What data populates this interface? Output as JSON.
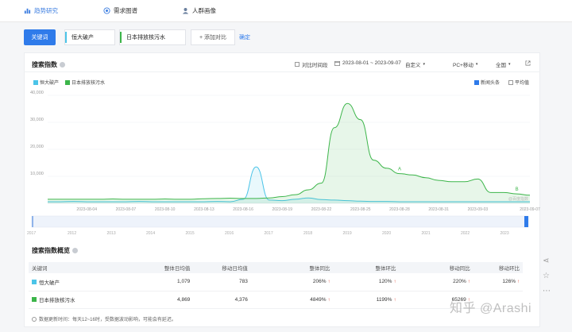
{
  "nav": {
    "items": [
      {
        "label": "趋势研究",
        "icon": "bar-chart-icon"
      },
      {
        "label": "需求图谱",
        "icon": "target-icon"
      },
      {
        "label": "人群画像",
        "icon": "user-icon"
      }
    ]
  },
  "search": {
    "keyword_button": "关键词",
    "keywords": [
      {
        "label": "恒大破产",
        "color": "#4bc4e8"
      },
      {
        "label": "日本排放核污水",
        "color": "#3cb54a"
      }
    ],
    "add_compare": "+ 添加对比",
    "confirm": "确定"
  },
  "panel": {
    "title": "搜索指数",
    "compare_period": "对比时间段",
    "date_range": "2023-08-01 ~ 2023-09-07",
    "custom": "自定义",
    "device": "PC+移动",
    "region": "全国",
    "news_headlines": "新闻头条",
    "average": "平均值"
  },
  "chart_data": {
    "type": "line",
    "ylim": [
      0,
      40000
    ],
    "yticks": [
      "40,000",
      "30,000",
      "20,000",
      "10,000"
    ],
    "x": [
      "2023-08-01",
      "2023-08-02",
      "2023-08-03",
      "2023-08-04",
      "2023-08-05",
      "2023-08-06",
      "2023-08-07",
      "2023-08-08",
      "2023-08-09",
      "2023-08-10",
      "2023-08-11",
      "2023-08-12",
      "2023-08-13",
      "2023-08-14",
      "2023-08-15",
      "2023-08-16",
      "2023-08-17",
      "2023-08-18",
      "2023-08-19",
      "2023-08-20",
      "2023-08-21",
      "2023-08-22",
      "2023-08-23",
      "2023-08-24",
      "2023-08-25",
      "2023-08-26",
      "2023-08-27",
      "2023-08-28",
      "2023-08-29",
      "2023-08-30",
      "2023-08-31",
      "2023-09-01",
      "2023-09-02",
      "2023-09-03",
      "2023-09-04",
      "2023-09-05",
      "2023-09-06",
      "2023-09-07"
    ],
    "xticks": [
      "2023-08-04",
      "2023-08-07",
      "2023-08-10",
      "2023-08-13",
      "2023-08-16",
      "2023-08-19",
      "2023-08-22",
      "2023-08-25",
      "2023-08-28",
      "2023-08-31",
      "2023-09-03",
      "2023-09-07"
    ],
    "series": [
      {
        "name": "恒大破产",
        "color": "#4bc4e8",
        "values": [
          600,
          600,
          700,
          600,
          600,
          600,
          600,
          700,
          600,
          600,
          600,
          600,
          600,
          700,
          600,
          1500,
          13500,
          1200,
          1000,
          1500,
          2000,
          1400,
          1200,
          1000,
          800,
          700,
          700,
          600,
          600,
          600,
          600,
          600,
          600,
          600,
          600,
          600,
          600,
          600
        ]
      },
      {
        "name": "日本排放核污水",
        "color": "#3cb54a",
        "values": [
          1500,
          1500,
          1500,
          1500,
          1500,
          1600,
          1500,
          1500,
          1500,
          1600,
          1500,
          1500,
          1700,
          1800,
          1900,
          1800,
          1800,
          2000,
          2500,
          3200,
          5000,
          7500,
          28000,
          37000,
          31000,
          16000,
          13000,
          11000,
          10500,
          9500,
          8500,
          8000,
          8000,
          9000,
          4000,
          4000,
          3500,
          3000
        ]
      }
    ],
    "annotations": [
      "A",
      "B"
    ],
    "watermark": "@百度指数",
    "timeline_years": [
      "2017",
      "2012",
      "2013",
      "2014",
      "2015",
      "2016",
      "2017",
      "2018",
      "2019",
      "2020",
      "2021",
      "2022",
      "2023"
    ]
  },
  "summary": {
    "title": "搜索指数概览",
    "headers": [
      "关键词",
      "整体日均值",
      "移动日均值",
      "整体同比",
      "整体环比",
      "移动同比",
      "移动环比"
    ],
    "rows": [
      {
        "keyword": "恒大破产",
        "color": "#4bc4e8",
        "overall_avg": "1,079",
        "mobile_avg": "783",
        "overall_yoy": "206%",
        "overall_mom": "120%",
        "mobile_yoy": "220%",
        "mobile_mom": "126%"
      },
      {
        "keyword": "日本排放核污水",
        "color": "#3cb54a",
        "overall_avg": "4,869",
        "mobile_avg": "4,376",
        "overall_yoy": "4849%",
        "overall_mom": "1199%",
        "mobile_yoy": "65269",
        "mobile_mom": ""
      }
    ],
    "footnote": "数据更新时间：每天12~16时，受数据波动影响，可能会有延迟。"
  },
  "watermark": "知乎 @Arashi"
}
